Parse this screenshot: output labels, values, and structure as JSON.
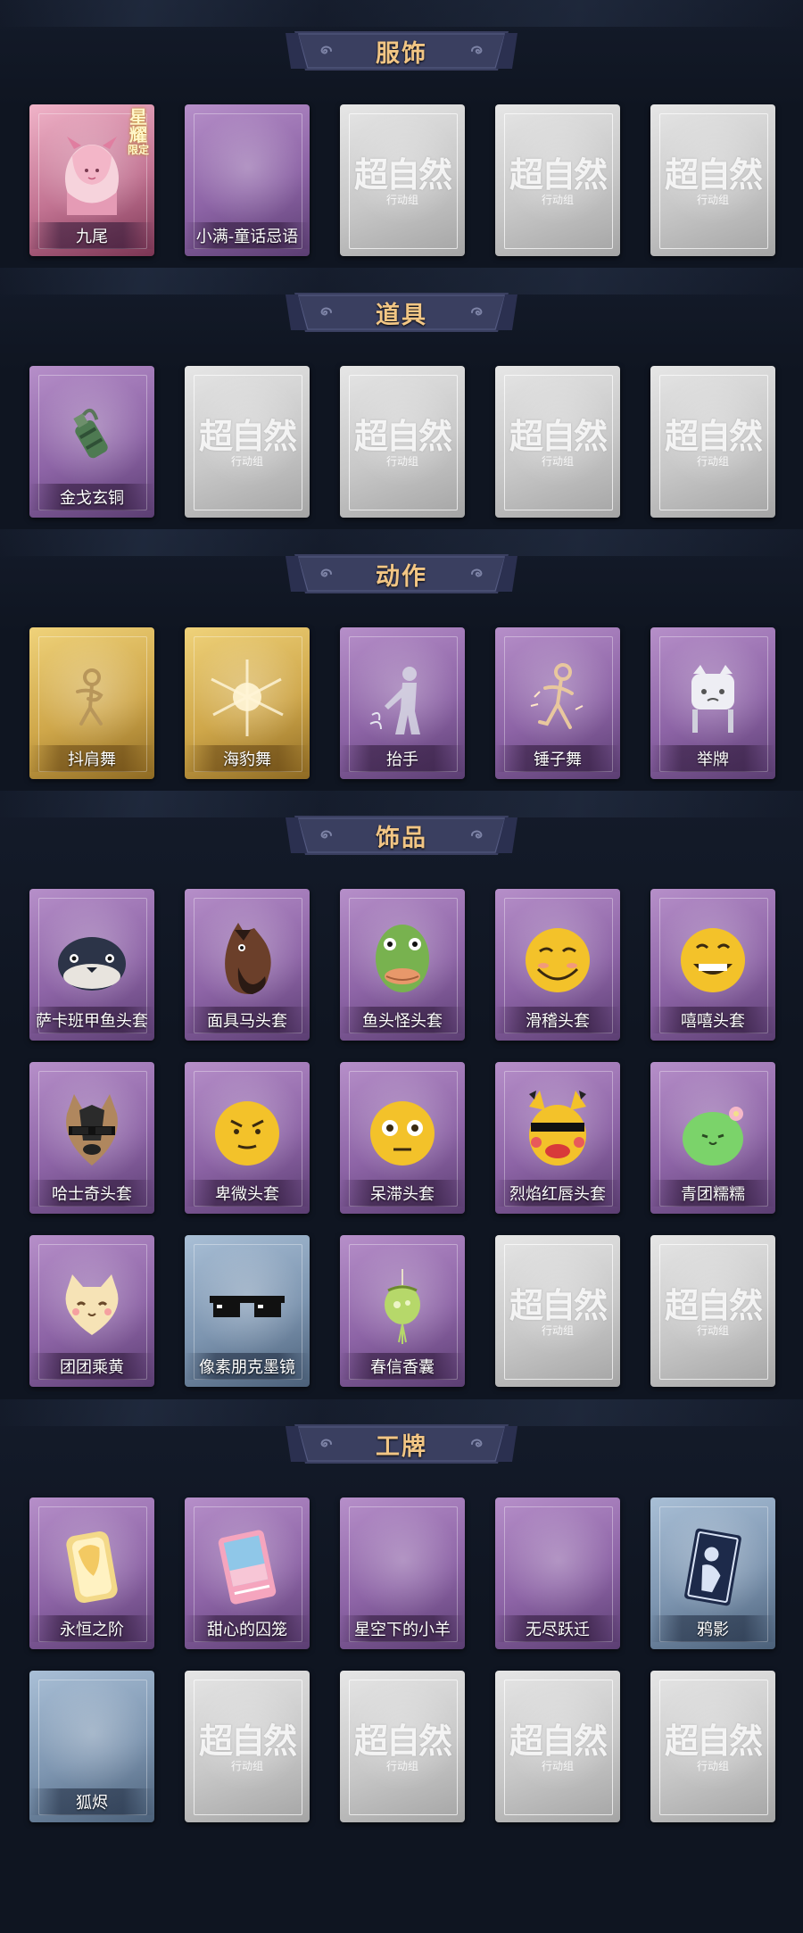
{
  "placeholder": {
    "main": "超自然",
    "sub": "行动组"
  },
  "sections": [
    {
      "title": "服饰",
      "items": [
        {
          "label": "九尾",
          "rarity": "pink",
          "icon": "fox-girl-portrait-icon",
          "badge": {
            "main": "星耀",
            "sub": "限定"
          }
        },
        {
          "label": "小满-童话忌语",
          "rarity": "purple",
          "icon": "blank"
        },
        {
          "label": "",
          "rarity": "grey",
          "icon": "placeholder"
        },
        {
          "label": "",
          "rarity": "grey",
          "icon": "placeholder"
        },
        {
          "label": "",
          "rarity": "grey",
          "icon": "placeholder"
        }
      ]
    },
    {
      "title": "道具",
      "items": [
        {
          "label": "金戈玄铜",
          "rarity": "purple",
          "icon": "bronze-grenade-icon"
        },
        {
          "label": "",
          "rarity": "grey",
          "icon": "placeholder"
        },
        {
          "label": "",
          "rarity": "grey",
          "icon": "placeholder"
        },
        {
          "label": "",
          "rarity": "grey",
          "icon": "placeholder"
        },
        {
          "label": "",
          "rarity": "grey",
          "icon": "placeholder"
        }
      ]
    },
    {
      "title": "动作",
      "items": [
        {
          "label": "抖肩舞",
          "rarity": "gold",
          "icon": "dance-figure-icon"
        },
        {
          "label": "海豹舞",
          "rarity": "gold",
          "icon": "burst-icon"
        },
        {
          "label": "抬手",
          "rarity": "purple",
          "icon": "raise-hand-icon"
        },
        {
          "label": "锤子舞",
          "rarity": "purple",
          "icon": "hammer-dance-icon"
        },
        {
          "label": "举牌",
          "rarity": "purple",
          "icon": "hold-sign-icon"
        }
      ]
    },
    {
      "title": "饰品",
      "items": [
        {
          "label": "萨卡班甲鱼头套",
          "rarity": "purple",
          "icon": "fish-head-icon"
        },
        {
          "label": "面具马头套",
          "rarity": "purple",
          "icon": "horse-head-icon"
        },
        {
          "label": "鱼头怪头套",
          "rarity": "purple",
          "icon": "frog-fish-head-icon"
        },
        {
          "label": "滑稽头套",
          "rarity": "purple",
          "icon": "funny-emoji-icon"
        },
        {
          "label": "嘻嘻头套",
          "rarity": "purple",
          "icon": "grin-emoji-icon"
        },
        {
          "label": "哈士奇头套",
          "rarity": "purple",
          "icon": "husky-head-icon"
        },
        {
          "label": "卑微头套",
          "rarity": "purple",
          "icon": "humble-emoji-icon"
        },
        {
          "label": "呆滞头套",
          "rarity": "purple",
          "icon": "dazed-emoji-icon"
        },
        {
          "label": "烈焰红唇头套",
          "rarity": "purple",
          "icon": "pikachu-lips-head-icon"
        },
        {
          "label": "青团糯糯",
          "rarity": "purple",
          "icon": "green-dumpling-icon"
        },
        {
          "label": "团团乘黄",
          "rarity": "purple",
          "icon": "cat-plush-icon"
        },
        {
          "label": "像素朋克墨镜",
          "rarity": "blue",
          "icon": "pixel-sunglasses-icon"
        },
        {
          "label": "春信香囊",
          "rarity": "purple",
          "icon": "sachet-icon"
        },
        {
          "label": "",
          "rarity": "grey",
          "icon": "placeholder"
        },
        {
          "label": "",
          "rarity": "grey",
          "icon": "placeholder"
        }
      ]
    },
    {
      "title": "工牌",
      "items": [
        {
          "label": "永恒之阶",
          "rarity": "purple",
          "icon": "golden-card-icon"
        },
        {
          "label": "甜心的囚笼",
          "rarity": "purple",
          "icon": "pink-card-icon"
        },
        {
          "label": "星空下的小羊",
          "rarity": "purple",
          "icon": "blank"
        },
        {
          "label": "无尽跃迁",
          "rarity": "purple",
          "icon": "blank"
        },
        {
          "label": "鸦影",
          "rarity": "blue",
          "icon": "raven-card-icon"
        },
        {
          "label": "狐烬",
          "rarity": "blue",
          "icon": "blank"
        },
        {
          "label": "",
          "rarity": "grey",
          "icon": "placeholder"
        },
        {
          "label": "",
          "rarity": "grey",
          "icon": "placeholder"
        },
        {
          "label": "",
          "rarity": "grey",
          "icon": "placeholder"
        },
        {
          "label": "",
          "rarity": "grey",
          "icon": "placeholder"
        }
      ]
    }
  ],
  "colors": {
    "background": "#0f1521",
    "title_text": "#f2c685",
    "banner": "#3a3f60"
  }
}
